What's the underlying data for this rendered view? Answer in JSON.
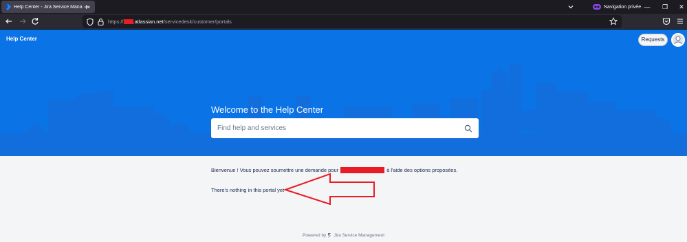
{
  "browser": {
    "tab_title": "Help Center - Jira Service Manage",
    "tab_close": "×",
    "new_tab": "+",
    "private_label": "Navigation privée",
    "url_prefix": "https://",
    "url_host": ".atlassian.net",
    "url_path": "/servicedesk/customer/portals",
    "minimize": "—",
    "restore": "❐",
    "close": "✕"
  },
  "header": {
    "title": "Help Center",
    "requests_label": "Requests",
    "welcome": "Welcome to the Help Center",
    "search_placeholder": "Find help and services"
  },
  "content": {
    "welcome_msg_before": "Bienvenue ! Vous pouvez soumettre une demande pour",
    "welcome_msg_after": "à l'aide des options proposées.",
    "empty_msg": "There's nothing in this portal yet"
  },
  "footer": {
    "powered_by": "Powered by",
    "product": "Jira Service Management"
  },
  "colors": {
    "header_blue": "#0a73e6",
    "annotation_red": "#e81c24"
  }
}
